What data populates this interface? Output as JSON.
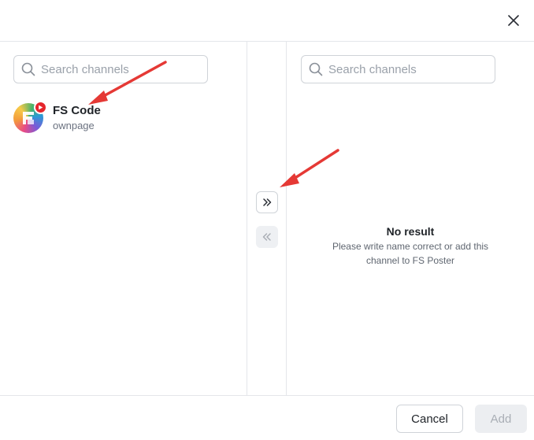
{
  "left_panel": {
    "search": {
      "placeholder": "Search channels",
      "value": ""
    },
    "channels": [
      {
        "name": "FS Code",
        "subtitle": "ownpage",
        "platform_badge": "youtube-icon"
      }
    ]
  },
  "right_panel": {
    "search": {
      "placeholder": "Search channels",
      "value": ""
    },
    "empty": {
      "title": "No result",
      "description": "Please write name correct or add this channel to FS Poster"
    }
  },
  "transfer": {
    "add_all_icon": "double-chevron-right-icon",
    "remove_all_icon": "double-chevron-left-icon"
  },
  "footer": {
    "cancel_label": "Cancel",
    "add_label": "Add"
  },
  "colors": {
    "annotation_arrow": "#e53935",
    "youtube_red": "#e5262c",
    "disabled_bg": "#eceef1",
    "border": "#cfd3d8"
  }
}
